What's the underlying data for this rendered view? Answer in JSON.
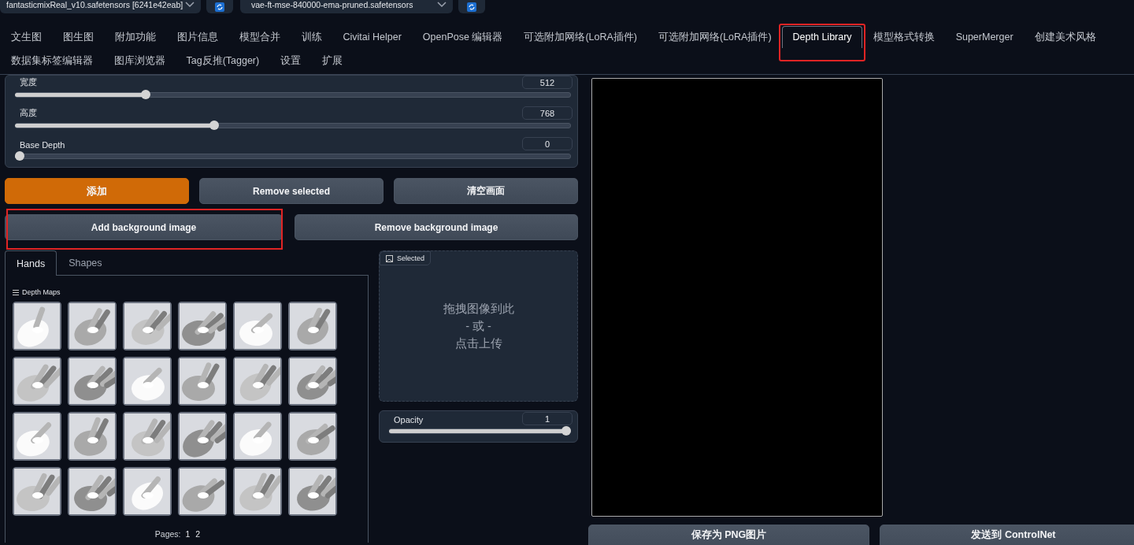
{
  "top_bar": {
    "checkpoint": {
      "value": "fantasticmixReal_v10.safetensors [6241e42eab]"
    },
    "vae": {
      "value": "vae-ft-mse-840000-ema-pruned.safetensors"
    }
  },
  "tab_rows": [
    [
      {
        "label": "文生图",
        "selected": false,
        "highlighted": false
      },
      {
        "label": "图生图",
        "selected": false,
        "highlighted": false
      },
      {
        "label": "附加功能",
        "selected": false,
        "highlighted": false
      },
      {
        "label": "图片信息",
        "selected": false,
        "highlighted": false
      },
      {
        "label": "模型合并",
        "selected": false,
        "highlighted": false
      },
      {
        "label": "训练",
        "selected": false,
        "highlighted": false
      },
      {
        "label": "Civitai Helper",
        "selected": false,
        "highlighted": false
      },
      {
        "label": "OpenPose 编辑器",
        "selected": false,
        "highlighted": false
      },
      {
        "label": "可选附加网络(LoRA插件)",
        "selected": false,
        "highlighted": false
      },
      {
        "label": "可选附加网络(LoRA插件)",
        "selected": false,
        "highlighted": false
      },
      {
        "label": "Depth Library",
        "selected": true,
        "highlighted": true
      },
      {
        "label": "模型格式转换",
        "selected": false,
        "highlighted": false
      },
      {
        "label": "SuperMerger",
        "selected": false,
        "highlighted": false
      },
      {
        "label": "创建美术风格",
        "selected": false,
        "highlighted": false
      }
    ],
    [
      {
        "label": "数据集标签编辑器",
        "selected": false,
        "highlighted": false
      },
      {
        "label": "图库浏览器",
        "selected": false,
        "highlighted": false
      },
      {
        "label": "Tag反推(Tagger)",
        "selected": false,
        "highlighted": false
      },
      {
        "label": "设置",
        "selected": false,
        "highlighted": false
      },
      {
        "label": "扩展",
        "selected": false,
        "highlighted": false
      }
    ]
  ],
  "sliders": [
    {
      "label": "宽度",
      "value": "512",
      "level": 0.23
    },
    {
      "label": "高度",
      "value": "768",
      "level": 0.356
    },
    {
      "label": "Base Depth",
      "value": "0",
      "level": 0
    }
  ],
  "button_rows": [
    [
      {
        "label": "添加",
        "kind": "primary",
        "highlighted": false
      },
      {
        "label": "Remove selected",
        "kind": "secondary",
        "highlighted": false
      },
      {
        "label": "清空画面",
        "kind": "secondary",
        "highlighted": false
      }
    ],
    [
      {
        "label": "Add background image",
        "kind": "secondary",
        "highlighted": true
      },
      {
        "label": "Remove background image",
        "kind": "secondary",
        "highlighted": false
      }
    ]
  ],
  "library": {
    "tabs": [
      {
        "label": "Hands",
        "selected": true
      },
      {
        "label": "Shapes",
        "selected": false
      }
    ],
    "gallery_label": "Depth Maps",
    "thumbnails": [
      {
        "kind": "picture"
      },
      {
        "kind": "picture"
      },
      {
        "kind": "picture"
      },
      {
        "kind": "picture"
      },
      {
        "kind": "picture"
      },
      {
        "kind": "picture"
      },
      {
        "kind": "picture"
      },
      {
        "kind": "picture"
      },
      {
        "kind": "picture"
      },
      {
        "kind": "picture"
      },
      {
        "kind": "picture"
      },
      {
        "kind": "picture"
      },
      {
        "kind": "picture"
      },
      {
        "kind": "picture"
      },
      {
        "kind": "picture"
      },
      {
        "kind": "picture"
      },
      {
        "kind": "picture"
      },
      {
        "kind": "picture"
      },
      {
        "kind": "picture"
      },
      {
        "kind": "picture"
      },
      {
        "kind": "picture"
      },
      {
        "kind": "picture"
      },
      {
        "kind": "picture"
      },
      {
        "kind": "picture"
      }
    ],
    "pages_label": "Pages:",
    "pages": [
      "1",
      "2"
    ]
  },
  "upload": {
    "label": "Selected",
    "lines": [
      "拖拽图像到此",
      "- 或 -",
      "点击上传"
    ]
  },
  "opacity": {
    "label": "Opacity",
    "value": "1",
    "level": 1
  },
  "canvas_buttons": [
    "保存为 PNG图片",
    "发送到 ControlNet"
  ]
}
